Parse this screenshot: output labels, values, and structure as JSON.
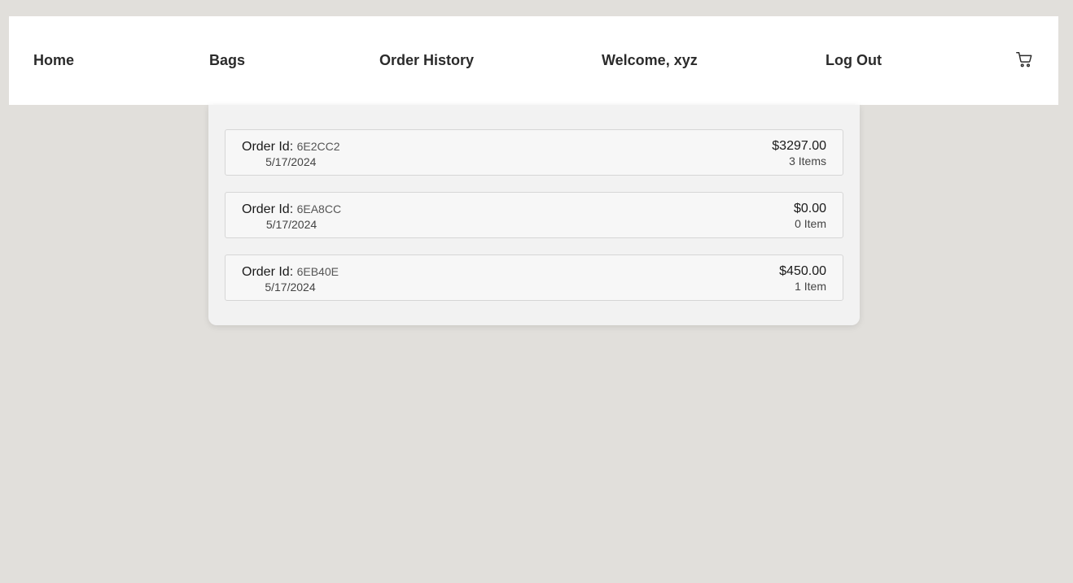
{
  "nav": {
    "home": "Home",
    "bags": "Bags",
    "order_history": "Order History",
    "welcome": "Welcome, xyz",
    "logout": "Log Out",
    "cart_icon": "shopping-cart-icon"
  },
  "orders": [
    {
      "label": "Order Id:",
      "id": "6E2CC2",
      "date": "5/17/2024",
      "total": "$3297.00",
      "items": "3 Items"
    },
    {
      "label": "Order Id:",
      "id": "6EA8CC",
      "date": "5/17/2024",
      "total": "$0.00",
      "items": "0 Item"
    },
    {
      "label": "Order Id:",
      "id": "6EB40E",
      "date": "5/17/2024",
      "total": "$450.00",
      "items": "1 Item"
    }
  ]
}
